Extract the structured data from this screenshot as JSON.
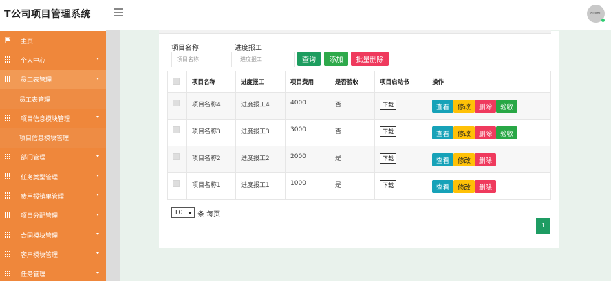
{
  "app": {
    "title": "T公司项目管理系统",
    "avatar_text": "80x80"
  },
  "sidebar": {
    "items": [
      {
        "label": "主页"
      },
      {
        "label": "个人中心"
      },
      {
        "label": "员工表管理"
      },
      {
        "label": "员工表管理"
      },
      {
        "label": "项目信息模块管理"
      },
      {
        "label": "项目信息模块管理"
      },
      {
        "label": "部门管理"
      },
      {
        "label": "任务类型管理"
      },
      {
        "label": "费用报销单管理"
      },
      {
        "label": "项目分配管理"
      },
      {
        "label": "合同模块管理"
      },
      {
        "label": "客户模块管理"
      },
      {
        "label": "任务管理"
      }
    ]
  },
  "search": {
    "name_label": "项目名称",
    "name_placeholder": "项目名称",
    "progress_label": "进度报工",
    "progress_placeholder": "进度报工",
    "query_btn": "查询",
    "add_btn": "添加",
    "batch_delete_btn": "批量删除"
  },
  "table": {
    "headers": [
      "项目名称",
      "进度报工",
      "项目费用",
      "是否验收",
      "项目启动书",
      "操作"
    ],
    "rows": [
      {
        "name": "项目名称4",
        "progress": "进度报工4",
        "cost": "4000",
        "accepted": "否",
        "download": "下载"
      },
      {
        "name": "项目名称3",
        "progress": "进度报工3",
        "cost": "3000",
        "accepted": "否",
        "download": "下载"
      },
      {
        "name": "项目名称2",
        "progress": "进度报工2",
        "cost": "2000",
        "accepted": "是",
        "download": "下载"
      },
      {
        "name": "项目名称1",
        "progress": "进度报工1",
        "cost": "1000",
        "accepted": "是",
        "download": "下载"
      }
    ],
    "ops": {
      "view": "查看",
      "edit": "修改",
      "delete": "删除",
      "accept": "验收"
    }
  },
  "pagination": {
    "page_size": "10",
    "per_page_text": "条 每页",
    "current_page": "1"
  },
  "colors": {
    "sidebar": "#ef873b",
    "query": "#1d9d5f",
    "add": "#2ea94b",
    "delete": "#ef3a5d",
    "view": "#17a2b8",
    "edit": "#ffc107",
    "accept": "#28a745",
    "page": "#1e9c63"
  }
}
